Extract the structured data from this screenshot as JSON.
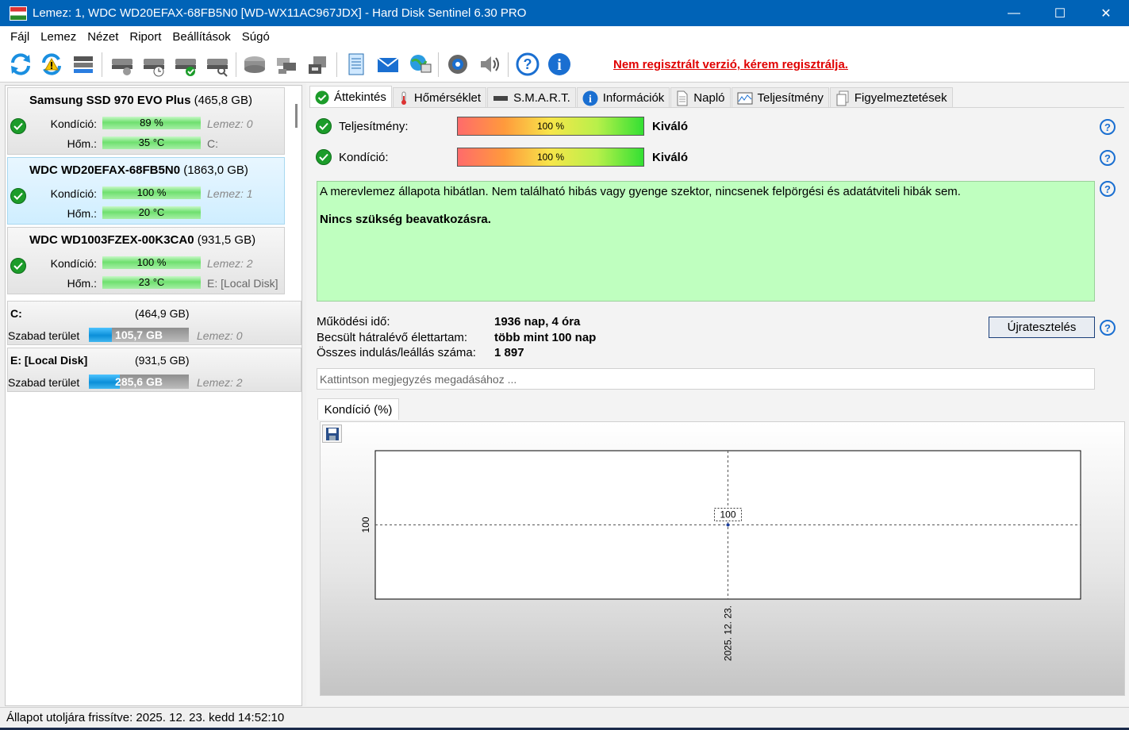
{
  "window": {
    "title": "Lemez: 1, WDC WD20EFAX-68FB5N0 [WD-WX11AC967JDX]  -  Hard Disk Sentinel 6.30 PRO",
    "minimize": "—",
    "maximize": "☐",
    "close": "✕"
  },
  "menu": [
    "Fájl",
    "Lemez",
    "Nézet",
    "Riport",
    "Beállítások",
    "Súgó"
  ],
  "toolbar": {
    "register_link": "Nem regisztrált verzió, kérem regisztrálja.",
    "buttons": [
      "refresh-icon",
      "refresh-warning-icon",
      "disk-list-icon",
      "disk-icon",
      "disk-clock-icon",
      "disk-ok-icon",
      "disk-search-icon",
      "disk-grey-icon",
      "disk-tools-icon",
      "disk-usb-icon",
      "report-icon",
      "email-icon",
      "network-icon",
      "settings-icon",
      "speaker-icon",
      "help-icon",
      "info-icon"
    ]
  },
  "disks": [
    {
      "name": "Samsung SSD 970 EVO Plus",
      "size": "(465,8 GB)",
      "condition_label": "Kondíció:",
      "condition": "89 %",
      "condition_extra": "Lemez: 0",
      "temp_label": "Hőm.:",
      "temp": "35 °C",
      "temp_extra": "C:"
    },
    {
      "name": "WDC WD20EFAX-68FB5N0",
      "size": "(1863,0 GB)",
      "condition_label": "Kondíció:",
      "condition": "100 %",
      "condition_extra": "Lemez: 1",
      "temp_label": "Hőm.:",
      "temp": "20 °C",
      "temp_extra": ""
    },
    {
      "name": "WDC WD1003FZEX-00K3CA0",
      "size": "(931,5 GB)",
      "condition_label": "Kondíció:",
      "condition": "100 %",
      "condition_extra": "Lemez: 2",
      "temp_label": "Hőm.:",
      "temp": "23 °C",
      "temp_extra": "E: [Local Disk]"
    }
  ],
  "partitions": [
    {
      "drive": "C:",
      "size": "(464,9 GB)",
      "free_label": "Szabad terület",
      "free": "105,7 GB",
      "free_fraction": 0.227,
      "disk": "Lemez: 0"
    },
    {
      "drive": "E: [Local Disk]",
      "size": "(931,5 GB)",
      "free_label": "Szabad terület",
      "free": "285,6 GB",
      "free_fraction": 0.307,
      "disk": "Lemez: 2"
    }
  ],
  "tabs": [
    "Áttekintés",
    "Hőmérséklet",
    "S.M.A.R.T.",
    "Információk",
    "Napló",
    "Teljesítmény",
    "Figyelmeztetések"
  ],
  "overview": {
    "performance_label": "Teljesítmény:",
    "performance_value": "100 %",
    "performance_rating": "Kiváló",
    "condition_label": "Kondíció:",
    "condition_value": "100 %",
    "condition_rating": "Kiváló",
    "status_text": "A merevlemez állapota hibátlan. Nem található hibás vagy gyenge szektor, nincsenek felpörgési és adatátviteli hibák sem.",
    "recommendation": "Nincs szükség beavatkozásra.",
    "uptime_label": "Működési idő:",
    "uptime": "1936 nap, 4 óra",
    "lifetime_label": "Becsült hátralévő élettartam:",
    "lifetime": "több mint 100 nap",
    "startstop_label": "Összes indulás/leállás száma:",
    "startstop": "1 897",
    "retest_button": "Újratesztelés",
    "note_placeholder": "Kattintson megjegyzés megadásához ..."
  },
  "graph": {
    "tab_label": "Kondíció  (%)"
  },
  "chart_data": {
    "type": "line",
    "x": [
      "2025. 12. 23."
    ],
    "series": [
      {
        "values": [
          100
        ]
      }
    ],
    "y_tick_labels": [
      "100"
    ],
    "data_labels": [
      "100"
    ]
  },
  "statusbar": {
    "text": "Állapot utoljára frissítve: 2025. 12. 23. kedd 14:52:10"
  }
}
